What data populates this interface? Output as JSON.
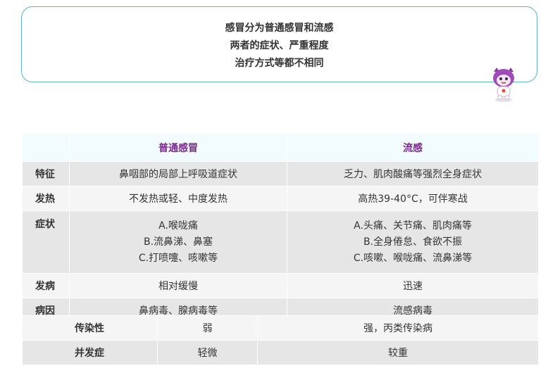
{
  "intro": {
    "lines": [
      "感冒分为普通感冒和流感",
      "两者的症状、严重程度",
      "治疗方式等都不相同"
    ]
  },
  "table": {
    "headers": [
      "",
      "普通感冒",
      "流感"
    ],
    "rows": [
      {
        "label": "特征",
        "common": [
          "鼻咽部的局部上呼吸道症状"
        ],
        "flu": [
          "乏力、肌肉酸痛等强烈全身症状"
        ]
      },
      {
        "label": "发热",
        "common": [
          "不发热或轻、中度发热"
        ],
        "flu": [
          "高热39-40°C，可伴寒战"
        ]
      },
      {
        "label": "症状",
        "common": [
          "A.喉咙痛",
          "B.流鼻涕、鼻塞",
          "C.打喷嚏、咳嗽等"
        ],
        "flu": [
          "A.头痛、关节痛、肌肉痛等",
          "B.全身倦怠、食欲不振",
          "C.咳嗽、喉咙痛、流鼻涕等"
        ]
      },
      {
        "label": "发病",
        "common": [
          "相对缓慢"
        ],
        "flu": [
          "迅速"
        ]
      },
      {
        "label": "病因",
        "common": [
          "鼻病毒、腺病毒等"
        ],
        "flu": [
          "流感病毒"
        ]
      }
    ],
    "extra_rows": [
      {
        "label": "传染性",
        "common": "弱",
        "flu": "强，丙类传染病"
      },
      {
        "label": "并发症",
        "common": "轻微",
        "flu": "较重"
      }
    ]
  },
  "colors": {
    "accent": "#7a2a8c",
    "border": "#5fb3c4",
    "header_bg": "#f2fbfd"
  }
}
